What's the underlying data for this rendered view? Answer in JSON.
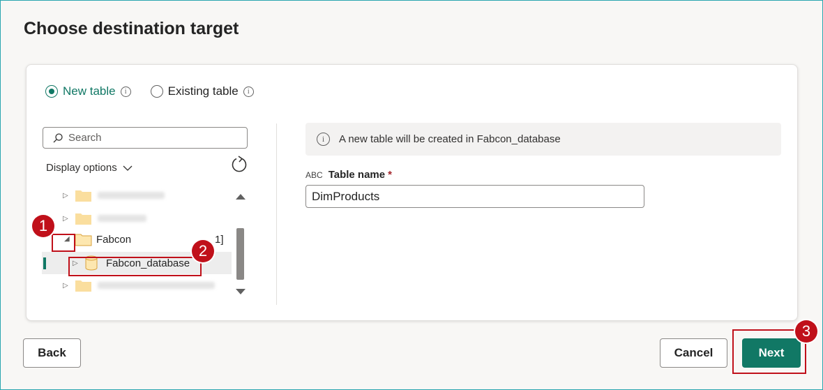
{
  "dialog": {
    "title": "Choose destination target"
  },
  "table_mode": {
    "options": [
      {
        "label": "New table",
        "selected": true
      },
      {
        "label": "Existing table",
        "selected": false
      }
    ],
    "info_glyph": "i"
  },
  "navigator": {
    "search_placeholder": "Search",
    "display_options_label": "Display options",
    "items": [
      {
        "label": "",
        "expanded": false
      },
      {
        "label": "",
        "expanded": false
      },
      {
        "label": "Fabcon",
        "expanded": true,
        "suffix": "1]"
      },
      {
        "label": "Fabcon_database",
        "expanded": false,
        "selected": true
      },
      {
        "label": "",
        "expanded": false
      }
    ]
  },
  "details": {
    "info_message": "A new table will be created in Fabcon_database",
    "table_name_label": "Table name",
    "required_marker": "*",
    "type_icon_text": "ABC",
    "table_name_value": "DimProducts"
  },
  "footer": {
    "back_label": "Back",
    "cancel_label": "Cancel",
    "next_label": "Next"
  },
  "callouts": [
    "1",
    "2",
    "3"
  ],
  "colors": {
    "accent": "#117865",
    "callout": "#c0101a",
    "folder": "#f7c85e"
  }
}
